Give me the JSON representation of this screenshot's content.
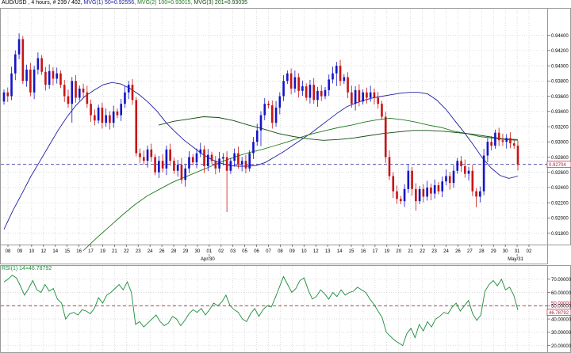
{
  "header": {
    "symbol": "AUD/USD",
    "timeframe": ", 4 hours, # 239 / 402,",
    "ma1": "MVG(1) 50=0.92556,",
    "ma2": "MVG(2) 100=0.93015,",
    "ma3": "MVG(3) 201=0.93035"
  },
  "colors": {
    "background": "#ffffff",
    "grid": "#c8c8c8",
    "bull_candle": "#1515c8",
    "bear_candle": "#c81515",
    "ma1_line": "#2020a0",
    "ma2_line": "#1f7a1f",
    "ma3_line": "#0f4a0f",
    "rsi_line": "#1a8c3a",
    "price_marker": "#b0203a",
    "rsi_marker": "#b0203a",
    "current_line": "#3a3aa0"
  },
  "rsi_label": "RSI(1) 14=46.78792",
  "chart_data": [
    {
      "type": "candlestick",
      "title": "AUD/USD , 4 hours",
      "ylim": [
        0.9165,
        0.9475
      ],
      "y_ticks": [
        "0.94400",
        "0.94200",
        "0.94000",
        "0.93800",
        "0.93600",
        "0.93400",
        "0.93200",
        "0.93000",
        "0.92800",
        "0.92600",
        "0.92400",
        "0.92200",
        "0.92000",
        "0.91800"
      ],
      "x_tick_labels": [
        "08",
        "09",
        "10",
        "12",
        "14",
        "15",
        "16",
        "17",
        "19",
        "21",
        "22",
        "23",
        "24",
        "26",
        "28",
        "29",
        "30",
        "01",
        "02",
        "03",
        "05",
        "06",
        "07",
        "08",
        "09",
        "10",
        "12",
        "13",
        "14",
        "15",
        "16",
        "17",
        "19",
        "20",
        "21",
        "22",
        "23",
        "24",
        "26",
        "27",
        "28",
        "29",
        "30",
        "31",
        "02"
      ],
      "month_labels": [
        "Apr/30",
        "May/31"
      ],
      "current_price": "0.92704",
      "current_value": 0.92704,
      "candles_close": [
        0.9365,
        0.936,
        0.939,
        0.9415,
        0.9435,
        0.938,
        0.9395,
        0.9365,
        0.9395,
        0.941,
        0.9392,
        0.9375,
        0.9393,
        0.9383,
        0.939,
        0.9375,
        0.936,
        0.935,
        0.938,
        0.9358,
        0.937,
        0.9365,
        0.935,
        0.9335,
        0.9328,
        0.9345,
        0.9325,
        0.9335,
        0.9325,
        0.934,
        0.9335,
        0.935,
        0.9365,
        0.9375,
        0.9355,
        0.9285,
        0.928,
        0.9275,
        0.929,
        0.928,
        0.926,
        0.9275,
        0.9265,
        0.929,
        0.9275,
        0.9262,
        0.927,
        0.925,
        0.9265,
        0.928,
        0.9273,
        0.9285,
        0.929,
        0.9268,
        0.9283,
        0.9275,
        0.9265,
        0.9278,
        0.928,
        0.9262,
        0.9275,
        0.9285,
        0.927,
        0.9275,
        0.9265,
        0.9285,
        0.93,
        0.9315,
        0.9335,
        0.935,
        0.9348,
        0.9325,
        0.9345,
        0.936,
        0.938,
        0.939,
        0.937,
        0.9385,
        0.9367,
        0.9373,
        0.9358,
        0.9375,
        0.9355,
        0.9367,
        0.936,
        0.9368,
        0.9382,
        0.939,
        0.94,
        0.938,
        0.9385,
        0.9365,
        0.935,
        0.9368,
        0.9353,
        0.9365,
        0.9358,
        0.9365,
        0.9358,
        0.935,
        0.9333,
        0.928,
        0.9255,
        0.9235,
        0.9225,
        0.9222,
        0.9238,
        0.9262,
        0.9238,
        0.9222,
        0.9238,
        0.9228,
        0.924,
        0.9232,
        0.9243,
        0.9235,
        0.9248,
        0.9255,
        0.9246,
        0.9262,
        0.9275,
        0.9268,
        0.9258,
        0.9262,
        0.9235,
        0.9228,
        0.9235,
        0.9282,
        0.93,
        0.9295,
        0.9312,
        0.9302,
        0.93,
        0.9305,
        0.9298,
        0.9295,
        0.927
      ],
      "series": [
        {
          "name": "MVG(1) 50",
          "values": [
            0.9185,
            0.921,
            0.9232,
            0.9255,
            0.9275,
            0.9295,
            0.9315,
            0.9333,
            0.9348,
            0.936,
            0.9368,
            0.9375,
            0.9378,
            0.9376,
            0.937,
            0.9362,
            0.9352,
            0.934,
            0.9325,
            0.9313,
            0.9302,
            0.9293,
            0.9284,
            0.9277,
            0.9272,
            0.9269,
            0.9268,
            0.9268,
            0.9269,
            0.9273,
            0.928,
            0.9287,
            0.9295,
            0.9303,
            0.9311,
            0.932,
            0.9329,
            0.9338,
            0.9346,
            0.9351,
            0.9355,
            0.9358,
            0.936,
            0.9362,
            0.9364,
            0.9365,
            0.9365,
            0.9363,
            0.9355,
            0.9343,
            0.9328,
            0.9313,
            0.9297,
            0.928,
            0.9266,
            0.9256,
            0.9252,
            0.9255
          ]
        },
        {
          "name": "MVG(2) 100",
          "values": [
            0.9157,
            0.9173,
            0.9188,
            0.9203,
            0.9217,
            0.9229,
            0.9238,
            0.9247,
            0.9254,
            0.9261,
            0.9268,
            0.9275,
            0.9281,
            0.9286,
            0.929,
            0.9295,
            0.93,
            0.9306,
            0.9311,
            0.9315,
            0.9319,
            0.9322,
            0.9326,
            0.9329,
            0.9331,
            0.9329,
            0.9326,
            0.9322,
            0.9319,
            0.9314,
            0.9311,
            0.9307,
            0.9305,
            0.9303,
            0.9302
          ]
        },
        {
          "name": "MVG(3) 201",
          "values": [
            0.9322,
            0.9327,
            0.933,
            0.9333,
            0.9332,
            0.9328,
            0.9322,
            0.9317,
            0.9311,
            0.9307,
            0.9304,
            0.9302,
            0.9303,
            0.9305,
            0.9308,
            0.9311,
            0.9313,
            0.9315,
            0.9315,
            0.9314,
            0.9312,
            0.931,
            0.9307,
            0.9304,
            0.9303
          ]
        }
      ]
    },
    {
      "type": "line",
      "title": "RSI(1) 14=46.78792",
      "ylim": [
        15,
        80
      ],
      "y_ticks": [
        "70.00000",
        "60.00000",
        "50.00000",
        "40.00000",
        "30.00000",
        "20.00000"
      ],
      "current_value": 46.78792,
      "current_label": "46.78792",
      "reference_value": 50,
      "reference_label": "50.00000",
      "values": [
        68,
        70,
        73,
        71,
        65,
        58,
        63,
        69,
        62,
        60,
        66,
        61,
        63,
        55,
        52,
        40,
        44,
        45,
        43,
        47,
        46,
        44,
        48,
        56,
        52,
        58,
        60,
        63,
        66,
        62,
        68,
        60,
        36,
        38,
        34,
        37,
        40,
        43,
        38,
        35,
        37,
        42,
        40,
        35,
        39,
        44,
        47,
        45,
        48,
        43,
        47,
        52,
        50,
        53,
        58,
        50,
        47,
        45,
        40,
        38,
        44,
        48,
        42,
        47,
        50,
        49,
        56,
        64,
        72,
        66,
        60,
        63,
        69,
        71,
        62,
        55,
        57,
        62,
        59,
        55,
        60,
        57,
        62,
        58,
        60,
        61,
        64,
        62,
        60,
        55,
        51,
        46,
        41,
        30,
        27,
        24,
        22,
        20,
        29,
        33,
        26,
        36,
        31,
        38,
        34,
        40,
        42,
        45,
        44,
        49,
        52,
        46,
        50,
        54,
        44,
        39,
        43,
        61,
        66,
        69,
        65,
        70,
        62,
        64,
        58,
        46.8
      ]
    }
  ]
}
